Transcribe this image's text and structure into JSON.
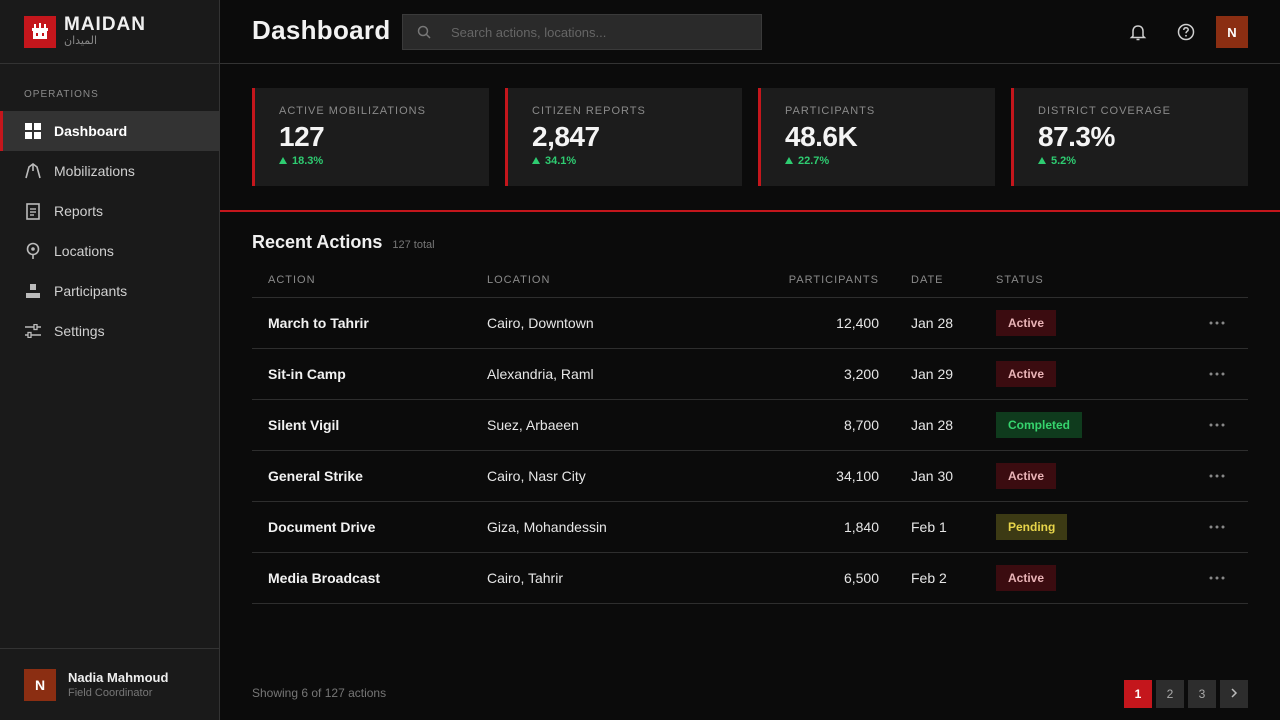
{
  "brand": {
    "name": "MAIDAN",
    "subtitle": "الميدان",
    "accent": "#c4161c"
  },
  "sidebar": {
    "section_label": "OPERATIONS",
    "items": [
      {
        "label": "Dashboard",
        "icon": "grid-icon",
        "active": true
      },
      {
        "label": "Mobilizations",
        "icon": "march-icon"
      },
      {
        "label": "Reports",
        "icon": "document-icon"
      },
      {
        "label": "Locations",
        "icon": "map-pin-icon"
      },
      {
        "label": "Participants",
        "icon": "person-icon"
      },
      {
        "label": "Settings",
        "icon": "sliders-icon"
      }
    ],
    "user": {
      "initial": "N",
      "name": "Nadia Mahmoud",
      "role": "Field Coordinator"
    }
  },
  "header": {
    "title": "Dashboard",
    "search_placeholder": "Search actions, locations...",
    "avatar_initial": "N"
  },
  "kpis": [
    {
      "label": "ACTIVE MOBILIZATIONS",
      "value": "127",
      "delta": "18.3%"
    },
    {
      "label": "CITIZEN REPORTS",
      "value": "2,847",
      "delta": "34.1%"
    },
    {
      "label": "PARTICIPANTS",
      "value": "48.6K",
      "delta": "22.7%"
    },
    {
      "label": "DISTRICT COVERAGE",
      "value": "87.3%",
      "delta": "5.2%"
    }
  ],
  "recent": {
    "title": "Recent Actions",
    "count": "127 total",
    "columns": {
      "action": "ACTION",
      "location": "LOCATION",
      "participants": "PARTICIPANTS",
      "date": "DATE",
      "status": "STATUS"
    },
    "rows": [
      {
        "action": "March to Tahrir",
        "location": "Cairo, Downtown",
        "participants": "12,400",
        "date": "Jan 28",
        "status": "Active",
        "status_kind": "active"
      },
      {
        "action": "Sit-in Camp",
        "location": "Alexandria, Raml",
        "participants": "3,200",
        "date": "Jan 29",
        "status": "Active",
        "status_kind": "active"
      },
      {
        "action": "Silent Vigil",
        "location": "Suez, Arbaeen",
        "participants": "8,700",
        "date": "Jan 28",
        "status": "Completed",
        "status_kind": "completed"
      },
      {
        "action": "General Strike",
        "location": "Cairo, Nasr City",
        "participants": "34,100",
        "date": "Jan 30",
        "status": "Active",
        "status_kind": "active"
      },
      {
        "action": "Document Drive",
        "location": "Giza, Mohandessin",
        "participants": "1,840",
        "date": "Feb 1",
        "status": "Pending",
        "status_kind": "pending"
      },
      {
        "action": "Media Broadcast",
        "location": "Cairo, Tahrir",
        "participants": "6,500",
        "date": "Feb 2",
        "status": "Active",
        "status_kind": "active"
      }
    ]
  },
  "footer": {
    "showing": "Showing 6 of 127 actions",
    "pages": [
      "1",
      "2",
      "3"
    ],
    "current_page": "1"
  }
}
